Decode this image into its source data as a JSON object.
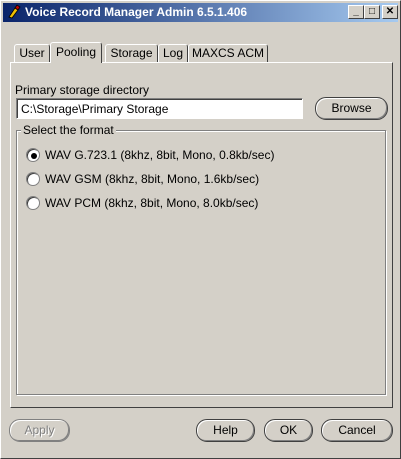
{
  "window": {
    "title": "Voice Record Manager Admin 6.5.1.406"
  },
  "titlebar": {
    "minimize": "_",
    "maximize": "□",
    "close": "✕"
  },
  "tabs": [
    {
      "label": "User",
      "active": false
    },
    {
      "label": "Pooling",
      "active": true
    },
    {
      "label": "Storage",
      "active": false
    },
    {
      "label": "Log",
      "active": false
    },
    {
      "label": "MAXCS ACM",
      "active": false
    }
  ],
  "storage": {
    "directory_label": "Primary storage directory",
    "directory_value": "C:\\Storage\\Primary Storage",
    "browse_label": "Browse"
  },
  "format": {
    "group_label": "Select the format",
    "options": [
      {
        "label": "WAV G.723.1 (8khz, 8bit, Mono, 0.8kb/sec)",
        "selected": true
      },
      {
        "label": "WAV GSM (8khz, 8bit, Mono, 1.6kb/sec)",
        "selected": false
      },
      {
        "label": "WAV PCM (8khz, 8bit, Mono, 8.0kb/sec)",
        "selected": false
      }
    ]
  },
  "footer": {
    "apply_label": "Apply",
    "help_label": "Help",
    "ok_label": "OK",
    "cancel_label": "Cancel"
  }
}
